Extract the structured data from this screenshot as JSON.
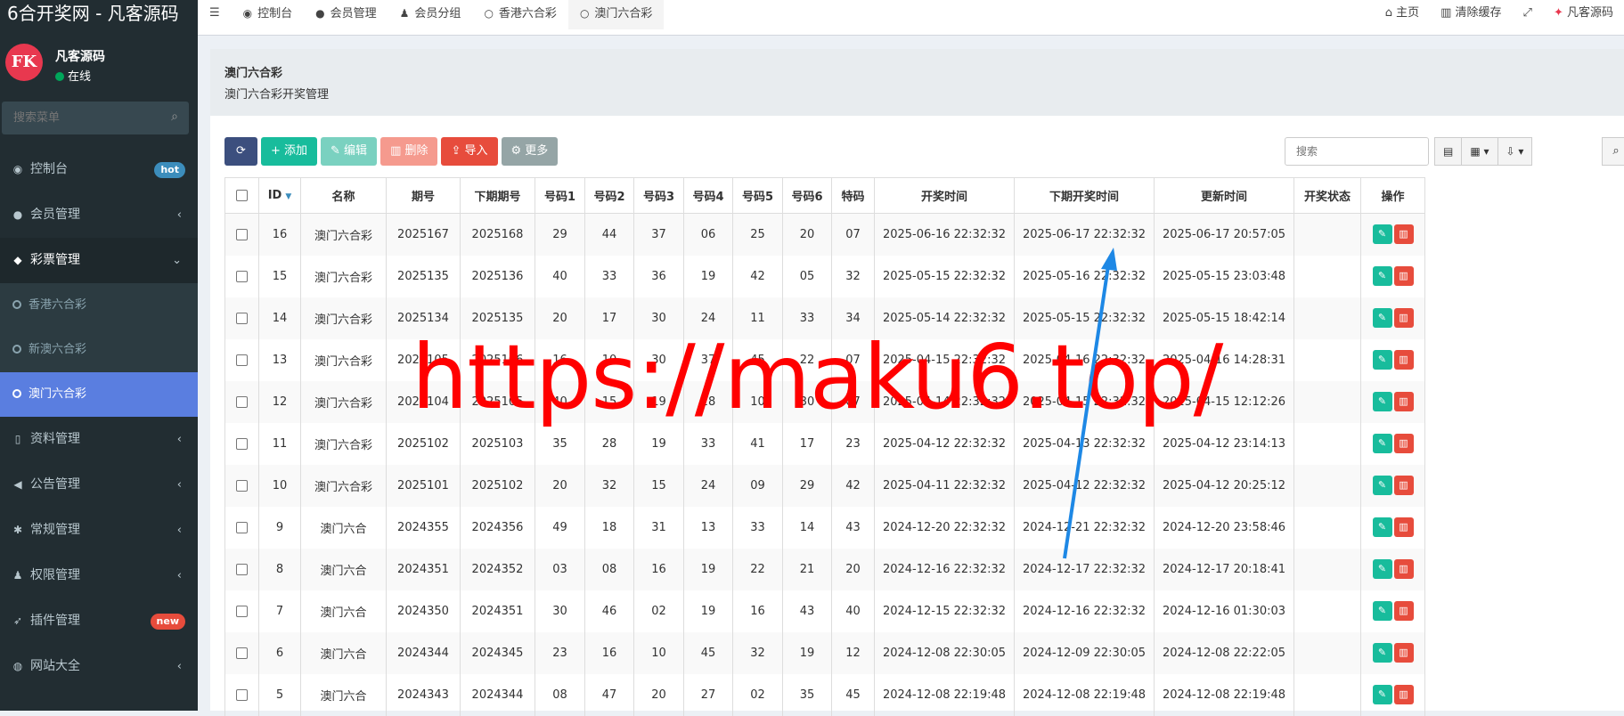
{
  "app": {
    "brand": "6合开奖网 - 凡客源码"
  },
  "user": {
    "avatar_text": "FK",
    "name": "凡客源码",
    "status": "在线"
  },
  "sidebar": {
    "search_placeholder": "搜索菜单",
    "items": [
      {
        "icon": "dashboard-icon",
        "glyph": "◉",
        "label": "控制台",
        "badge": "hot",
        "badge_color": "#3c8dbc"
      },
      {
        "icon": "user-circle-icon",
        "glyph": "●",
        "label": "会员管理",
        "chevron": "‹"
      },
      {
        "icon": "tags-icon",
        "glyph": "◆",
        "label": "彩票管理",
        "chevron": "⌄",
        "open": true
      },
      {
        "icon": "file-icon",
        "glyph": "▯",
        "label": "资料管理",
        "chevron": "‹"
      },
      {
        "icon": "bullhorn-icon",
        "glyph": "◀",
        "label": "公告管理",
        "chevron": "‹"
      },
      {
        "icon": "cogs-icon",
        "glyph": "✱",
        "label": "常规管理",
        "chevron": "‹"
      },
      {
        "icon": "group-icon",
        "glyph": "♟",
        "label": "权限管理",
        "chevron": "‹"
      },
      {
        "icon": "rocket-icon",
        "glyph": "➶",
        "label": "插件管理",
        "badge": "new",
        "badge_color": "#e74c3c"
      },
      {
        "icon": "globe-icon",
        "glyph": "◍",
        "label": "网站大全",
        "chevron": "‹"
      }
    ],
    "submenu": [
      "香港六合彩",
      "新澳六合彩",
      "澳门六合彩"
    ],
    "submenu_active": 2
  },
  "topnav": {
    "tabs": [
      {
        "icon": "dashboard-icon",
        "glyph": "◉",
        "label": "控制台"
      },
      {
        "icon": "user-icon",
        "glyph": "●",
        "label": "会员管理"
      },
      {
        "icon": "users-icon",
        "glyph": "♟",
        "label": "会员分组"
      },
      {
        "icon": "circle-icon",
        "glyph": "○",
        "label": "香港六合彩"
      },
      {
        "icon": "circle-icon",
        "glyph": "○",
        "label": "澳门六合彩",
        "active": true
      }
    ],
    "right": [
      {
        "icon": "home-icon",
        "glyph": "⌂",
        "label": "主页"
      },
      {
        "icon": "trash-icon",
        "glyph": "▥",
        "label": "清除缓存"
      },
      {
        "icon": "fullscreen-icon",
        "glyph": "⤢",
        "label": ""
      },
      {
        "icon": "avatar-icon",
        "glyph": "✦",
        "label": "凡客源码"
      }
    ]
  },
  "page": {
    "title": "澳门六合彩",
    "subtitle": "澳门六合彩开奖管理"
  },
  "toolbar": {
    "refresh": "⟳",
    "add": "+ 添加",
    "edit": "✎ 编辑",
    "delete": "▥ 删除",
    "import": "⇪ 导入",
    "more": "⚙ 更多",
    "search_placeholder": "搜索"
  },
  "table": {
    "columns": [
      "ID",
      "名称",
      "期号",
      "下期期号",
      "号码1",
      "号码2",
      "号码3",
      "号码4",
      "号码5",
      "号码6",
      "特码",
      "开奖时间",
      "下期开奖时间",
      "更新时间",
      "开奖状态",
      "操作"
    ],
    "rows": [
      [
        "16",
        "澳门六合彩",
        "2025167",
        "2025168",
        "29",
        "44",
        "37",
        "06",
        "25",
        "20",
        "07",
        "2025-06-16 22:32:32",
        "2025-06-17 22:32:32",
        "2025-06-17 20:57:05",
        ""
      ],
      [
        "15",
        "澳门六合彩",
        "2025135",
        "2025136",
        "40",
        "33",
        "36",
        "19",
        "42",
        "05",
        "32",
        "2025-05-15 22:32:32",
        "2025-05-16 22:32:32",
        "2025-05-15 23:03:48",
        ""
      ],
      [
        "14",
        "澳门六合彩",
        "2025134",
        "2025135",
        "20",
        "17",
        "30",
        "24",
        "11",
        "33",
        "34",
        "2025-05-14 22:32:32",
        "2025-05-15 22:32:32",
        "2025-05-15 18:42:14",
        ""
      ],
      [
        "13",
        "澳门六合彩",
        "2025105",
        "2025106",
        "16",
        "10",
        "30",
        "37",
        "45",
        "22",
        "07",
        "2025-04-15 22:32:32",
        "2025-04-16 22:32:32",
        "2025-04-16 14:28:31",
        ""
      ],
      [
        "12",
        "澳门六合彩",
        "2025104",
        "2025105",
        "40",
        "15",
        "19",
        "28",
        "10",
        "30",
        "07",
        "2025-04-14 22:32:32",
        "2025-04-15 22:32:32",
        "2025-04-15 12:12:26",
        ""
      ],
      [
        "11",
        "澳门六合彩",
        "2025102",
        "2025103",
        "35",
        "28",
        "19",
        "33",
        "41",
        "17",
        "23",
        "2025-04-12 22:32:32",
        "2025-04-13 22:32:32",
        "2025-04-12 23:14:13",
        ""
      ],
      [
        "10",
        "澳门六合彩",
        "2025101",
        "2025102",
        "20",
        "32",
        "15",
        "24",
        "09",
        "29",
        "42",
        "2025-04-11 22:32:32",
        "2025-04-12 22:32:32",
        "2025-04-12 20:25:12",
        ""
      ],
      [
        "9",
        "澳门六合",
        "2024355",
        "2024356",
        "49",
        "18",
        "31",
        "13",
        "33",
        "14",
        "43",
        "2024-12-20 22:32:32",
        "2024-12-21 22:32:32",
        "2024-12-20 23:58:46",
        ""
      ],
      [
        "8",
        "澳门六合",
        "2024351",
        "2024352",
        "03",
        "08",
        "16",
        "19",
        "22",
        "21",
        "20",
        "2024-12-16 22:32:32",
        "2024-12-17 22:32:32",
        "2024-12-17 20:18:41",
        ""
      ],
      [
        "7",
        "澳门六合",
        "2024350",
        "2024351",
        "30",
        "46",
        "02",
        "19",
        "16",
        "43",
        "40",
        "2024-12-15 22:32:32",
        "2024-12-16 22:32:32",
        "2024-12-16 01:30:03",
        ""
      ],
      [
        "6",
        "澳门六合",
        "2024344",
        "2024345",
        "23",
        "16",
        "10",
        "45",
        "32",
        "19",
        "12",
        "2024-12-08 22:30:05",
        "2024-12-09 22:30:05",
        "2024-12-08 22:22:05",
        ""
      ],
      [
        "5",
        "澳门六合",
        "2024343",
        "2024344",
        "08",
        "47",
        "20",
        "27",
        "02",
        "35",
        "45",
        "2024-12-08 22:19:48",
        "2024-12-08 22:19:48",
        "2024-12-08 22:19:48",
        ""
      ]
    ]
  },
  "watermark": "https://maku6.top/",
  "colors": {
    "sidebar": "#222d32",
    "accent": "#5a7ee0",
    "watermark": "#ff0000",
    "arrow": "#1e88e5"
  }
}
